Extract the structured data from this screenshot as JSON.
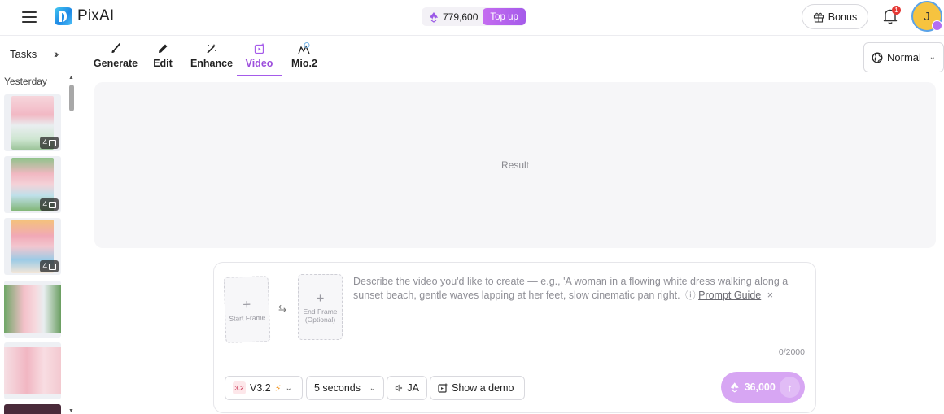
{
  "app": {
    "name": "PixAI"
  },
  "header": {
    "credits": "779,600",
    "topup_label": "Top up",
    "bonus_label": "Bonus",
    "notification_count": "1",
    "avatar_initial": "J"
  },
  "sidebar": {
    "tasks_label": "Tasks",
    "collapse_icon": "double-chevron-right",
    "group_label": "Yesterday",
    "thumbnails": [
      {
        "count": "4"
      },
      {
        "count": "4"
      },
      {
        "count": "4"
      },
      {
        "count": ""
      },
      {
        "count": ""
      }
    ]
  },
  "tabs": [
    {
      "label": "Generate",
      "icon": "brush-icon"
    },
    {
      "label": "Edit",
      "icon": "pencil-icon"
    },
    {
      "label": "Enhance",
      "icon": "sparkle-wand-icon"
    },
    {
      "label": "Video",
      "icon": "video-add-icon",
      "active": true
    },
    {
      "label": "Mio.2",
      "icon": "mio-icon"
    }
  ],
  "mode_select": {
    "value": "Normal"
  },
  "result": {
    "placeholder": "Result"
  },
  "prompt": {
    "start_frame_label": "Start Frame",
    "end_frame_label_1": "End Frame",
    "end_frame_label_2": "(Optional)",
    "placeholder": "Describe the video you'd like to create — e.g., 'A woman in a flowing white dress walking along a sunset beach, gentle waves lapping at her feet, slow cinematic pan right.",
    "guide_label": "Prompt Guide",
    "char_count": "0/2000",
    "model_label": "V3.2",
    "model_badge": "3.2",
    "duration_label": "5 seconds",
    "audio_label": "JA",
    "demo_label": "Show a demo",
    "generate_cost": "36,000"
  },
  "colors": {
    "accent": "#a55bea",
    "generate_button": "#d7a6f3",
    "avatar": "#f6c33f"
  }
}
